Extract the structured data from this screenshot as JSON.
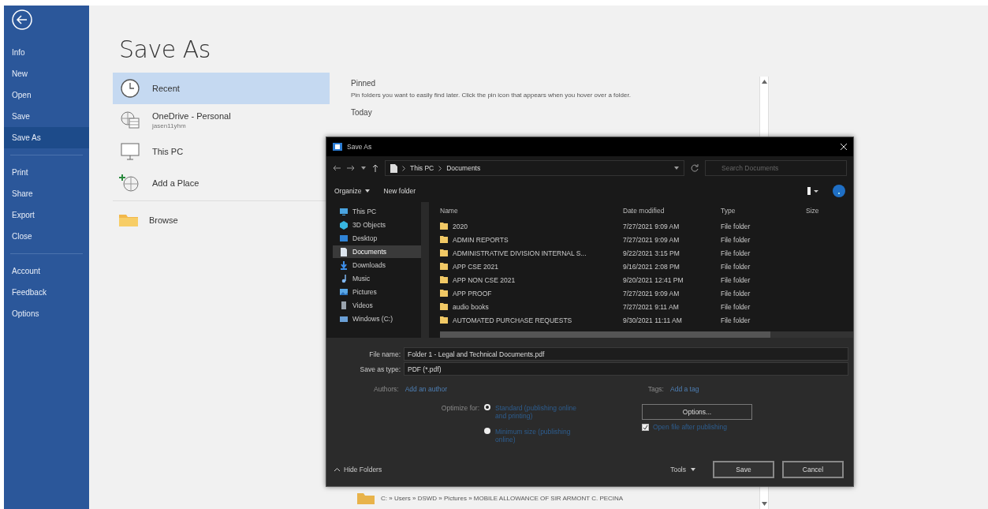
{
  "sidebar": {
    "groups": [
      {
        "items": [
          {
            "label": "Info",
            "selected": false
          },
          {
            "label": "New",
            "selected": false
          },
          {
            "label": "Open",
            "selected": false
          },
          {
            "label": "Save",
            "selected": false
          },
          {
            "label": "Save As",
            "selected": true
          }
        ]
      },
      {
        "items": [
          {
            "label": "Print",
            "selected": false
          },
          {
            "label": "Share",
            "selected": false
          },
          {
            "label": "Export",
            "selected": false
          },
          {
            "label": "Close",
            "selected": false
          }
        ]
      },
      {
        "items": [
          {
            "label": "Account",
            "selected": false
          },
          {
            "label": "Feedback",
            "selected": false
          },
          {
            "label": "Options",
            "selected": false
          }
        ]
      }
    ]
  },
  "backstage": {
    "title": "Save As",
    "places": [
      {
        "label": "Recent",
        "kind": "recent",
        "selected": true
      },
      {
        "label": "OneDrive - Personal",
        "subtitle": "jasen11yhm",
        "kind": "cloud",
        "selected": false
      },
      {
        "label": "This PC",
        "kind": "pc",
        "selected": false
      },
      {
        "label": "Add a Place",
        "kind": "add",
        "selected": false
      },
      {
        "label": "Browse",
        "kind": "browse",
        "selected": false
      }
    ]
  },
  "recent": {
    "pinned_heading": "Pinned",
    "pinned_hint": "Pin folders you want to easily find later. Click the pin icon that appears when you hover over a folder.",
    "today_heading": "Today",
    "folder_path": "C: » Users » DSWD » Pictures » MOBILE ALLOWANCE OF SIR ARMONT C. PECINA"
  },
  "dialog": {
    "title": "Save As",
    "path": [
      "This PC",
      "Documents"
    ],
    "search_placeholder": "Search Documents",
    "organize": "Organize",
    "new_folder": "New folder",
    "nav_items": [
      {
        "label": "This PC",
        "kind": "pc",
        "selected": false
      },
      {
        "label": "3D Objects",
        "kind": "cube",
        "selected": false
      },
      {
        "label": "Desktop",
        "kind": "desktop",
        "selected": false
      },
      {
        "label": "Documents",
        "kind": "doc",
        "selected": true
      },
      {
        "label": "Downloads",
        "kind": "download",
        "selected": false
      },
      {
        "label": "Music",
        "kind": "music",
        "selected": false
      },
      {
        "label": "Pictures",
        "kind": "pictures",
        "selected": false
      },
      {
        "label": "Videos",
        "kind": "video",
        "selected": false
      },
      {
        "label": "Windows (C:)",
        "kind": "drive",
        "selected": false
      }
    ],
    "columns": [
      "Name",
      "Date modified",
      "Type",
      "Size"
    ],
    "rows": [
      {
        "name": "2020",
        "date": "7/27/2021 9:09 AM",
        "type": "File folder"
      },
      {
        "name": "ADMIN REPORTS",
        "date": "7/27/2021 9:09 AM",
        "type": "File folder"
      },
      {
        "name": "ADMINISTRATIVE DIVISION INTERNAL S...",
        "date": "9/22/2021 3:15 PM",
        "type": "File folder"
      },
      {
        "name": "APP CSE 2021",
        "date": "9/16/2021 2:08 PM",
        "type": "File folder"
      },
      {
        "name": "APP NON CSE 2021",
        "date": "9/20/2021 12:41 PM",
        "type": "File folder"
      },
      {
        "name": "APP PROOF",
        "date": "7/27/2021 9:09 AM",
        "type": "File folder"
      },
      {
        "name": "audio books",
        "date": "7/27/2021 9:11 AM",
        "type": "File folder"
      },
      {
        "name": "AUTOMATED PURCHASE REQUESTS",
        "date": "9/30/2021 11:11 AM",
        "type": "File folder"
      }
    ],
    "file_name_label": "File name:",
    "file_name": "Folder 1 - Legal and Technical Documents.pdf",
    "type_label": "Save as type:",
    "save_type": "PDF (*.pdf)",
    "authors_label": "Authors:",
    "authors_value": "Add an author",
    "tags_label": "Tags:",
    "tags_value": "Add a tag",
    "optimize_label": "Optimize for:",
    "optimize_options": [
      {
        "label": "Standard (publishing online and printing)",
        "selected": true
      },
      {
        "label": "Minimum size (publishing online)",
        "selected": false
      }
    ],
    "options_button": "Options...",
    "open_after": {
      "label": "Open file after publishing",
      "checked": true
    },
    "hide_folders": "Hide Folders",
    "tools": "Tools",
    "buttons": [
      "Save",
      "Cancel"
    ]
  }
}
